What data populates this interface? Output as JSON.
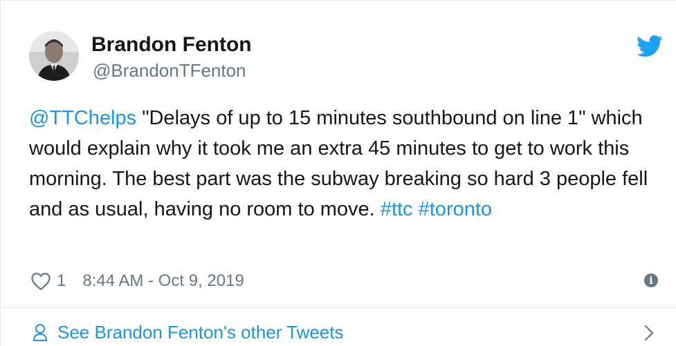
{
  "author": {
    "name": "Brandon Fenton",
    "handle": "@BrandonTFenton"
  },
  "tweet": {
    "mention": "@TTChelps",
    "body": " \"Delays of up to 15 minutes southbound on line 1\" which would explain why it took me an extra 45 minutes to get to work this morning. The best part was the subway breaking so hard 3 people fell and as usual, having no room to move. ",
    "hashtag_1": "#ttc",
    "hashtag_2": "#toronto"
  },
  "meta": {
    "like_count": "1",
    "timestamp": "8:44 AM - Oct 9, 2019"
  },
  "footer": {
    "more_tweets_label": "See Brandon Fenton's other Tweets"
  },
  "icons": {
    "brand": "twitter-bird-icon",
    "like": "heart-icon",
    "info": "info-icon",
    "profile": "person-icon",
    "chevron": "chevron-right-icon"
  },
  "colors": {
    "link": "#1b95e0",
    "secondary_text": "#657786",
    "primary_text": "#14171a",
    "border": "#e1e8ed"
  }
}
